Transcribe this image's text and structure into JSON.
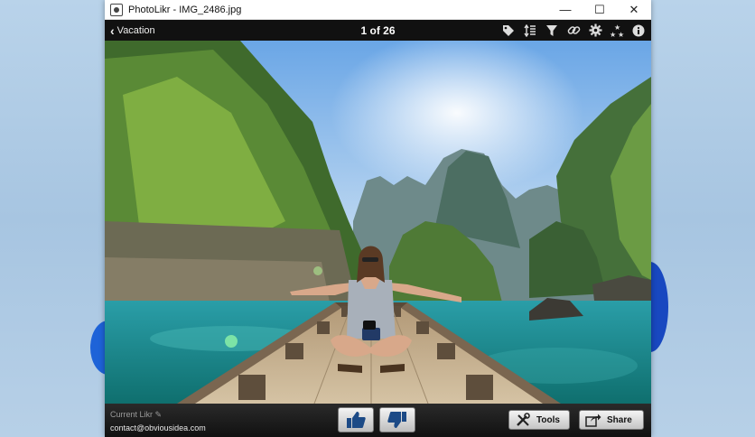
{
  "window": {
    "title": "PhotoLikr - IMG_2486.jpg",
    "controls": {
      "minimize": "—",
      "maximize": "☐",
      "close": "✕"
    }
  },
  "toolbar": {
    "back_label": "Vacation",
    "counter": "1 of 26",
    "icons": [
      "tag-icon",
      "sort-icon",
      "filter-icon",
      "link-icon",
      "gear-icon",
      "rating-stars-icon",
      "info-icon"
    ]
  },
  "footer": {
    "current_likr": "Current Likr",
    "contact": "contact@obviousidea.com",
    "tools_label": "Tools",
    "share_label": "Share"
  },
  "colors": {
    "window_bg": "#000000",
    "toolbar_bg": "#111111",
    "desktop_bg": "#b9d3ea"
  }
}
